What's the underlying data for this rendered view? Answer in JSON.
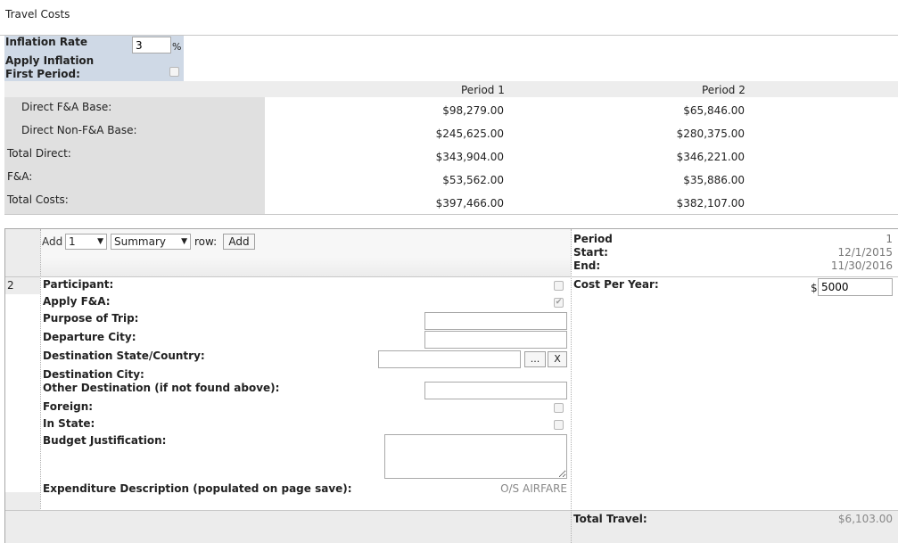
{
  "page_title": "Travel Costs",
  "inflation": {
    "rate_label": "Inflation Rate",
    "rate_value": "3",
    "percent_sign": "%",
    "apply_label_line1": "Apply Inflation",
    "apply_label_line2": "First Period:"
  },
  "summary": {
    "headers": [
      "Period 1",
      "Period 2"
    ],
    "rows": [
      {
        "label": "Direct F&A Base:",
        "p1": "$98,279.00",
        "p2": "$65,846.00"
      },
      {
        "label": "Direct Non-F&A Base:",
        "p1": "$245,625.00",
        "p2": "$280,375.00"
      },
      {
        "label": "Total Direct:",
        "p1": "$343,904.00",
        "p2": "$346,221.00"
      },
      {
        "label": "F&A:",
        "p1": "$53,562.00",
        "p2": "$35,886.00"
      },
      {
        "label": "Total Costs:",
        "p1": "$397,466.00",
        "p2": "$382,107.00"
      }
    ]
  },
  "add_row": {
    "add_label": "Add",
    "count_value": "1",
    "type_value": "Summary",
    "row_label": "row:",
    "add_button": "Add"
  },
  "period_info": {
    "period_label": "Period",
    "period_value": "1",
    "start_label": "Start:",
    "start_value": "12/1/2015",
    "end_label": "End:",
    "end_value": "11/30/2016"
  },
  "entry": {
    "row_number": "2",
    "participant_label": "Participant:",
    "apply_fa_label": "Apply F&A:",
    "purpose_label": "Purpose of Trip:",
    "departure_label": "Departure City:",
    "dest_state_label": "Destination State/Country:",
    "browse_button": "...",
    "clear_button": "X",
    "dest_city_label": "Destination City:",
    "other_dest_label": "Other Destination (if not found above):",
    "foreign_label": "Foreign:",
    "in_state_label": "In State:",
    "justification_label": "Budget Justification:",
    "expenditure_label": "Expenditure Description (populated on page save):",
    "expenditure_value": "O/S AIRFARE",
    "cost_label": "Cost Per Year:",
    "cost_currency": "$",
    "cost_value": "5000"
  },
  "total": {
    "label": "Total Travel:",
    "value": "$6,103.00"
  }
}
